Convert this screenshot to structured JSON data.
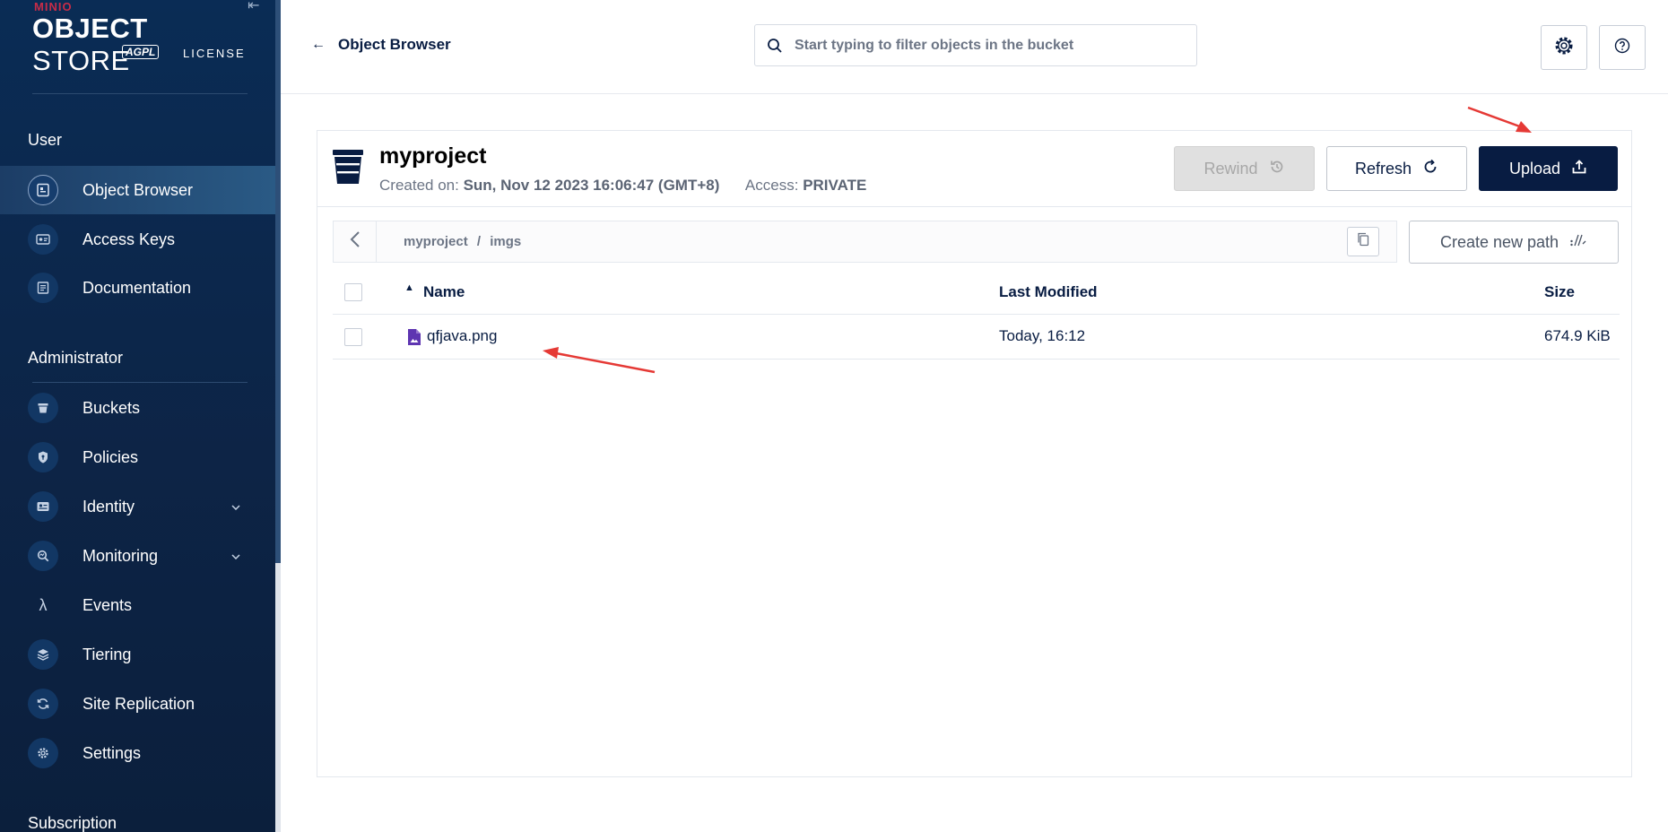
{
  "brand": {
    "minio": "MINIO",
    "title_bold": "OBJECT",
    "title_light": "STORE",
    "agpl": "AGPL",
    "license": "LICENSE"
  },
  "sidebar": {
    "user_section": "User",
    "admin_section": "Administrator",
    "subscription_section": "Subscription",
    "user_items": [
      {
        "label": "Object Browser",
        "icon": "object-browser-icon",
        "active": true
      },
      {
        "label": "Access Keys",
        "icon": "access-keys-icon"
      },
      {
        "label": "Documentation",
        "icon": "documentation-icon"
      }
    ],
    "admin_items": [
      {
        "label": "Buckets",
        "icon": "bucket-icon"
      },
      {
        "label": "Policies",
        "icon": "policy-shield-icon"
      },
      {
        "label": "Identity",
        "icon": "identity-icon",
        "expandable": true
      },
      {
        "label": "Monitoring",
        "icon": "monitoring-icon",
        "expandable": true
      },
      {
        "label": "Events",
        "icon": "lambda-icon"
      },
      {
        "label": "Tiering",
        "icon": "tiering-layers-icon"
      },
      {
        "label": "Site Replication",
        "icon": "replication-icon"
      },
      {
        "label": "Settings",
        "icon": "gear-icon"
      }
    ]
  },
  "header": {
    "back_label": "Object Browser",
    "search_placeholder": "Start typing to filter objects in the bucket"
  },
  "bucket": {
    "name": "myproject",
    "created_label": "Created on:",
    "created_value": "Sun, Nov 12 2023 16:06:47 (GMT+8)",
    "access_label": "Access:",
    "access_value": "PRIVATE",
    "rewind_label": "Rewind",
    "refresh_label": "Refresh",
    "upload_label": "Upload"
  },
  "path": {
    "segments": [
      "myproject",
      "/",
      "imgs"
    ],
    "create_new_path_label": "Create new path"
  },
  "table": {
    "columns": [
      "Name",
      "Last Modified",
      "Size"
    ],
    "rows": [
      {
        "name": "qfjava.png",
        "modified": "Today, 16:12",
        "size": "674.9 KiB"
      }
    ]
  },
  "colors": {
    "sidebar_bg": "#0d2446",
    "primary": "#081c42",
    "annotation": "#e53935",
    "file_icon": "#5e35b1"
  }
}
